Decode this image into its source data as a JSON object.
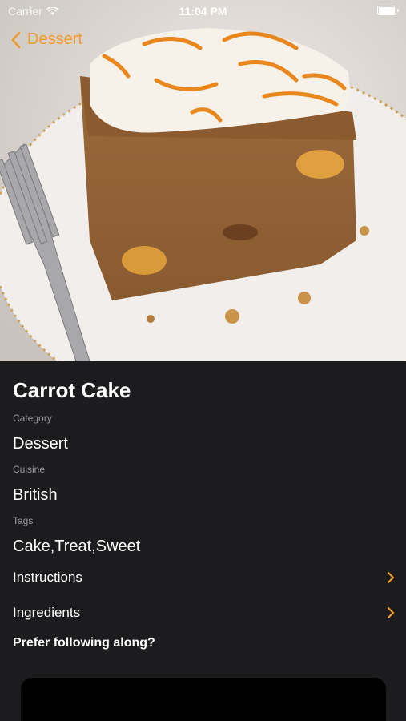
{
  "status": {
    "carrier": "Carrier",
    "time": "11:04 PM"
  },
  "nav": {
    "back_label": "Dessert"
  },
  "meal": {
    "title": "Carrot Cake",
    "category_label": "Category",
    "category": "Dessert",
    "cuisine_label": "Cuisine",
    "cuisine": "British",
    "tags_label": "Tags",
    "tags": "Cake,Treat,Sweet"
  },
  "rows": {
    "instructions": "Instructions",
    "ingredients": "Ingredients"
  },
  "prompt": "Prefer following along?",
  "colors": {
    "accent": "#ef9a2b",
    "background": "#1c1c1e"
  }
}
